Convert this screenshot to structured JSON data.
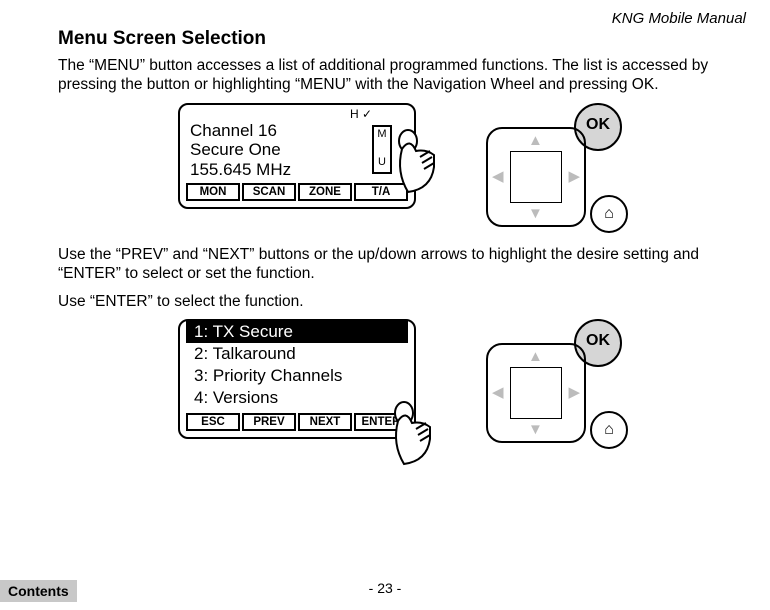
{
  "header": {
    "manual_title": "KNG Mobile Manual"
  },
  "section": {
    "title": "Menu Screen Selection"
  },
  "para1": "The “MENU” button accesses a list of additional programmed functions. The list is accessed by pressing the button or highlighting “MENU” with the Navigation Wheel and pressing OK.",
  "fig1": {
    "indicator": "H      ✓",
    "line1": "Channel 16",
    "line2": "Secure One",
    "line3": "155.645 MHz",
    "menu_letter_top": "M",
    "menu_letter_bottom": "U",
    "softkeys": [
      "MON",
      "SCAN",
      "ZONE",
      "T/A"
    ]
  },
  "para2": "Use the “PREV” and “NEXT” buttons or the up/down arrows to highlight the desire setting and “ENTER” to select or set the function.",
  "para3": "Use “ENTER” to select the function.",
  "fig2": {
    "items": [
      "1: TX Secure",
      "2: Talkaround",
      "3: Priority Channels",
      "4: Versions"
    ],
    "softkeys": [
      "ESC",
      "PREV",
      "NEXT",
      "ENTER"
    ]
  },
  "nav": {
    "ok": "OK"
  },
  "footer": {
    "page": "- 23 -",
    "contents": "Contents"
  }
}
